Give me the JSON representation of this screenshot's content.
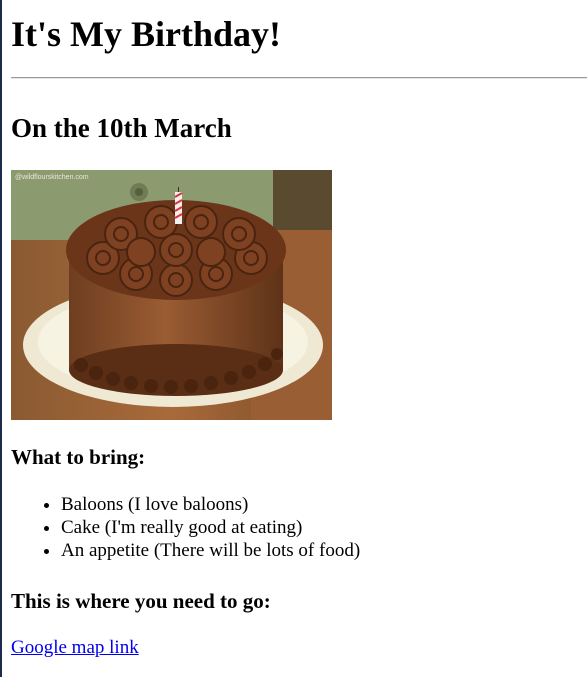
{
  "page": {
    "title": "It's My Birthday!",
    "date_heading": "On the 10th March",
    "image_watermark": "@wildflourskitchen.com",
    "bring_heading": "What to bring:",
    "bring_items": [
      "Baloons (I love baloons)",
      "Cake (I'm really good at eating)",
      "An appetite (There will be lots of food)"
    ],
    "where_heading": "This is where you need to go:",
    "map_link": "Google map link"
  }
}
